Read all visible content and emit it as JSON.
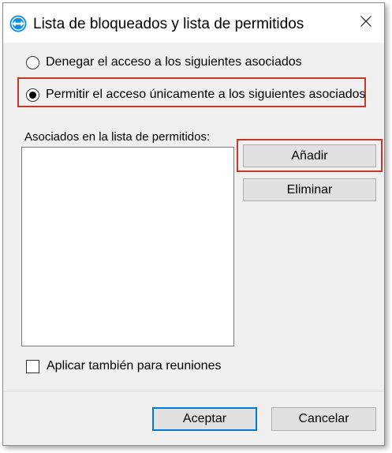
{
  "window": {
    "title": "Lista de bloqueados y lista de permitidos",
    "app_icon": "teamviewer-logo-icon",
    "close_icon": "close-icon"
  },
  "access_options": [
    {
      "label": "Denegar el acceso a los siguientes asociados",
      "checked": false
    },
    {
      "label": "Permitir el acceso únicamente a los siguientes asociados",
      "checked": true
    }
  ],
  "list": {
    "label": "Asociados en la lista de permitidos:",
    "items": []
  },
  "list_buttons": {
    "add_label": "Añadir",
    "remove_label": "Eliminar"
  },
  "meetings_option": {
    "label": "Aplicar también para reuniones",
    "checked": false
  },
  "footer": {
    "accept_label": "Aceptar",
    "cancel_label": "Cancelar"
  },
  "colors": {
    "highlight": "#c0392b",
    "logo_blue": "#0e8ee9",
    "default_button_border": "#0078d7"
  }
}
